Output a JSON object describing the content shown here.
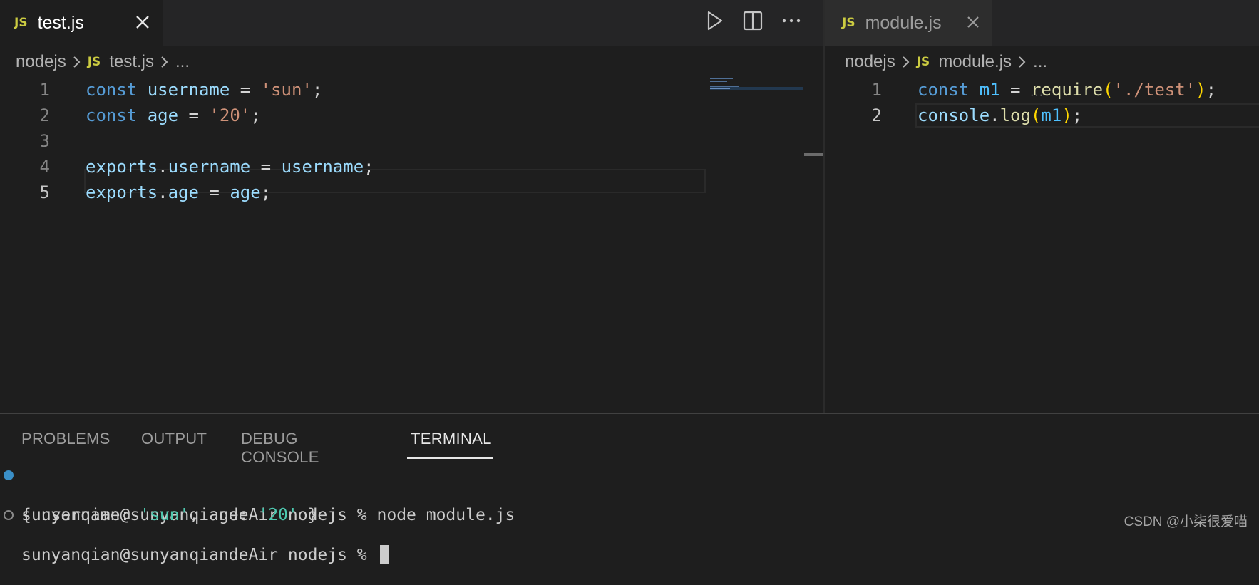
{
  "left_editor": {
    "tab": {
      "badge": "JS",
      "label": "test.js"
    },
    "breadcrumb": {
      "folder": "nodejs",
      "badge": "JS",
      "file": "test.js",
      "more": "..."
    },
    "lines": [
      {
        "num": "1",
        "tokens": [
          [
            "kw",
            "const"
          ],
          [
            "op",
            " "
          ],
          [
            "var",
            "username"
          ],
          [
            "op",
            " = "
          ],
          [
            "str",
            "'sun'"
          ],
          [
            "op",
            ";"
          ]
        ]
      },
      {
        "num": "2",
        "tokens": [
          [
            "kw",
            "const"
          ],
          [
            "op",
            " "
          ],
          [
            "var",
            "age"
          ],
          [
            "op",
            " = "
          ],
          [
            "str",
            "'20'"
          ],
          [
            "op",
            ";"
          ]
        ]
      },
      {
        "num": "3",
        "tokens": []
      },
      {
        "num": "4",
        "tokens": [
          [
            "var",
            "exports"
          ],
          [
            "op",
            "."
          ],
          [
            "var",
            "username"
          ],
          [
            "op",
            " = "
          ],
          [
            "var",
            "username"
          ],
          [
            "op",
            ";"
          ]
        ]
      },
      {
        "num": "5",
        "tokens": [
          [
            "var",
            "exports"
          ],
          [
            "op",
            "."
          ],
          [
            "var",
            "age"
          ],
          [
            "op",
            " = "
          ],
          [
            "var",
            "age"
          ],
          [
            "op",
            ";"
          ]
        ]
      }
    ],
    "current_line": 5
  },
  "right_editor": {
    "tab": {
      "badge": "JS",
      "label": "module.js"
    },
    "breadcrumb": {
      "folder": "nodejs",
      "badge": "JS",
      "file": "module.js",
      "more": "..."
    },
    "lines": [
      {
        "num": "1",
        "tokens": [
          [
            "kw",
            "const"
          ],
          [
            "op",
            " "
          ],
          [
            "vc",
            "m1"
          ],
          [
            "op",
            " = "
          ],
          [
            "fn",
            "require"
          ],
          [
            "paren",
            "("
          ],
          [
            "str",
            "'./test'"
          ],
          [
            "paren",
            ")"
          ],
          [
            "op",
            ";"
          ]
        ]
      },
      {
        "num": "2",
        "tokens": [
          [
            "var",
            "console"
          ],
          [
            "op",
            "."
          ],
          [
            "fn",
            "log"
          ],
          [
            "paren",
            "("
          ],
          [
            "vc",
            "m1"
          ],
          [
            "paren",
            ")"
          ],
          [
            "op",
            ";"
          ]
        ]
      }
    ],
    "current_line": 2
  },
  "icons": {
    "run": "play-icon",
    "split": "split-editor-icon",
    "more": "more-actions-icon",
    "close": "close-icon",
    "chevron": "chevron-right-icon"
  },
  "panel": {
    "tabs": [
      "PROBLEMS",
      "OUTPUT",
      "DEBUG CONSOLE",
      "TERMINAL"
    ],
    "active_tab": "TERMINAL",
    "terminal": {
      "line1": "sunyanqian@sunyanqiandeAir nodejs % node module.js",
      "line2_prefix": "{ username: ",
      "line2_val1": "'sun'",
      "line2_mid": ", age: ",
      "line2_val2": "'20'",
      "line2_suffix": " }",
      "line3": "sunyanqian@sunyanqiandeAir nodejs % "
    }
  },
  "watermark": "CSDN @小柒很爱喵",
  "colors": {
    "background": "#1e1e1e",
    "keyword": "#569cd6",
    "variable": "#9cdcfe",
    "string": "#ce9178",
    "function": "#dcdcaa",
    "js_badge": "#cbcb41"
  }
}
